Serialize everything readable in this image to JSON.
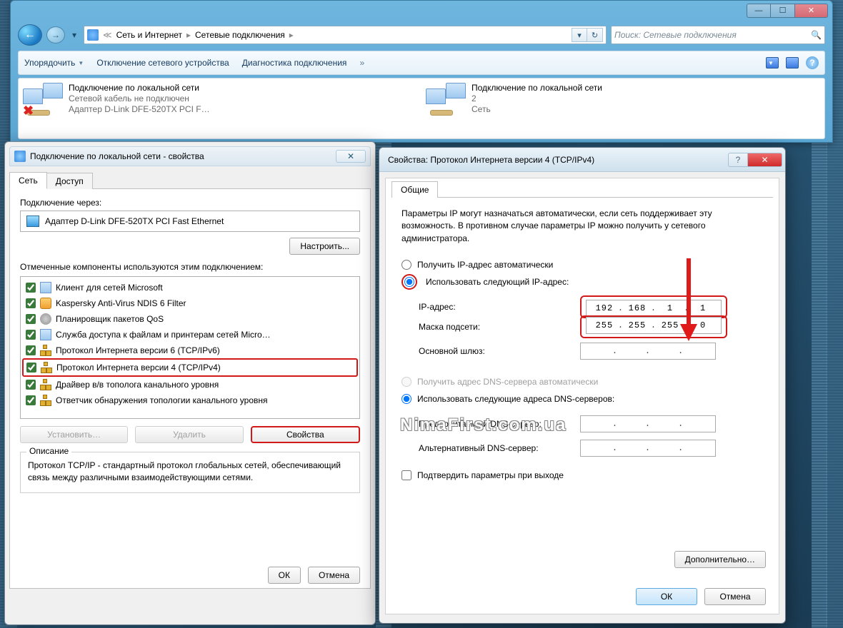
{
  "explorer": {
    "breadcrumb": [
      "Сеть и Интернет",
      "Сетевые подключения"
    ],
    "search_placeholder": "Поиск: Сетевые подключения",
    "toolbar": {
      "organize": "Упорядочить",
      "disable": "Отключение сетевого устройства",
      "diagnose": "Диагностика подключения",
      "more": "»"
    },
    "connections": [
      {
        "title": "Подключение по локальной сети",
        "line2": "Сетевой кабель не подключен",
        "line3": "Адаптер D-Link DFE-520TX PCI F…",
        "error": true
      },
      {
        "title": "Подключение по локальной сети",
        "line2": "2",
        "line3": "Сеть",
        "error": false
      }
    ]
  },
  "dlg1": {
    "title": "Подключение по локальной сети - свойства",
    "tabs": {
      "network": "Сеть",
      "access": "Доступ"
    },
    "connect_via_label": "Подключение через:",
    "adapter": "Адаптер D-Link DFE-520TX PCI Fast Ethernet",
    "configure_btn": "Настроить...",
    "components_label": "Отмеченные компоненты используются этим подключением:",
    "components": [
      {
        "label": "Клиент для сетей Microsoft",
        "icon": "pc"
      },
      {
        "label": "Kaspersky Anti-Virus NDIS 6 Filter",
        "icon": "shield"
      },
      {
        "label": "Планировщик пакетов QoS",
        "icon": "gear"
      },
      {
        "label": "Служба доступа к файлам и принтерам сетей Micro…",
        "icon": "pc"
      },
      {
        "label": "Протокол Интернета версии 6 (TCP/IPv6)",
        "icon": "net"
      },
      {
        "label": "Протокол Интернета версии 4 (TCP/IPv4)",
        "icon": "net",
        "highlight": true
      },
      {
        "label": "Драйвер в/в тополога канального уровня",
        "icon": "net"
      },
      {
        "label": "Ответчик обнаружения топологии канального уровня",
        "icon": "net"
      }
    ],
    "install_btn": "Установить…",
    "remove_btn": "Удалить",
    "properties_btn": "Свойства",
    "desc_legend": "Описание",
    "desc_text": "Протокол TCP/IP - стандартный протокол глобальных сетей, обеспечивающий связь между различными взаимодействующими сетями.",
    "ok": "ОК",
    "cancel": "Отмена"
  },
  "dlg2": {
    "title": "Свойства: Протокол Интернета версии 4 (TCP/IPv4)",
    "tab_general": "Общие",
    "info": "Параметры IP могут назначаться автоматически, если сеть поддерживает эту возможность. В противном случае параметры IP можно получить у сетевого администратора.",
    "radio_ip_auto": "Получить IP-адрес автоматически",
    "radio_ip_manual": "Использовать следующий IP-адрес:",
    "ip_label": "IP-адрес:",
    "ip_value": [
      "192",
      "168",
      "1",
      "1"
    ],
    "mask_label": "Маска подсети:",
    "mask_value": [
      "255",
      "255",
      "255",
      "0"
    ],
    "gateway_label": "Основной шлюз:",
    "gateway_value": [
      "",
      "",
      "",
      ""
    ],
    "radio_dns_auto": "Получить адрес DNS-сервера автоматически",
    "radio_dns_manual": "Использовать следующие адреса DNS-серверов:",
    "dns1_label": "Предпочитаемый DNS-сервер:",
    "dns1_value": [
      "",
      "",
      "",
      ""
    ],
    "dns2_label": "Альтернативный DNS-сервер:",
    "dns2_value": [
      "",
      "",
      "",
      ""
    ],
    "confirm_on_exit": "Подтвердить параметры при выходе",
    "advanced_btn": "Дополнительно…",
    "ok": "ОК",
    "cancel": "Отмена"
  },
  "watermark": "NimaFirst.com.ua"
}
